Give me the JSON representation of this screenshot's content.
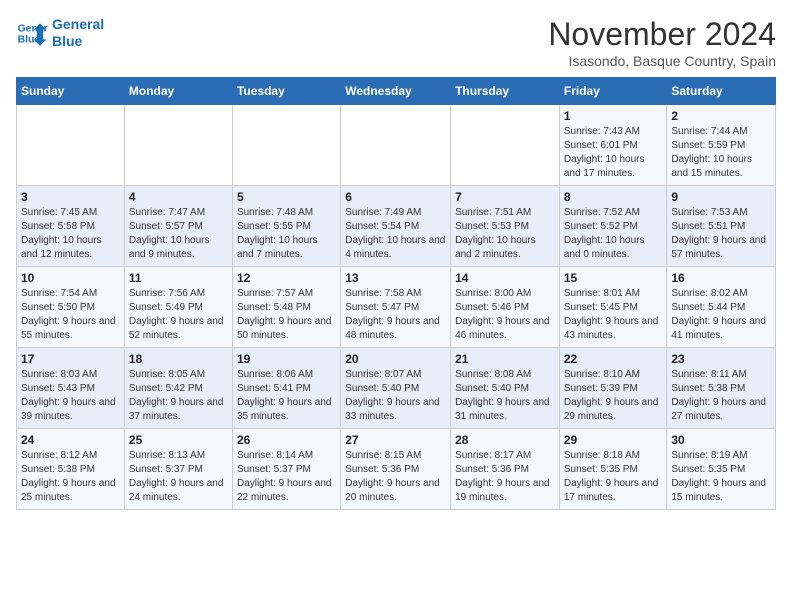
{
  "header": {
    "logo_line1": "General",
    "logo_line2": "Blue",
    "month": "November 2024",
    "location": "Isasondo, Basque Country, Spain"
  },
  "weekdays": [
    "Sunday",
    "Monday",
    "Tuesday",
    "Wednesday",
    "Thursday",
    "Friday",
    "Saturday"
  ],
  "weeks": [
    [
      {
        "day": "",
        "info": ""
      },
      {
        "day": "",
        "info": ""
      },
      {
        "day": "",
        "info": ""
      },
      {
        "day": "",
        "info": ""
      },
      {
        "day": "",
        "info": ""
      },
      {
        "day": "1",
        "info": "Sunrise: 7:43 AM\nSunset: 6:01 PM\nDaylight: 10 hours and 17 minutes."
      },
      {
        "day": "2",
        "info": "Sunrise: 7:44 AM\nSunset: 5:59 PM\nDaylight: 10 hours and 15 minutes."
      }
    ],
    [
      {
        "day": "3",
        "info": "Sunrise: 7:45 AM\nSunset: 5:58 PM\nDaylight: 10 hours and 12 minutes."
      },
      {
        "day": "4",
        "info": "Sunrise: 7:47 AM\nSunset: 5:57 PM\nDaylight: 10 hours and 9 minutes."
      },
      {
        "day": "5",
        "info": "Sunrise: 7:48 AM\nSunset: 5:55 PM\nDaylight: 10 hours and 7 minutes."
      },
      {
        "day": "6",
        "info": "Sunrise: 7:49 AM\nSunset: 5:54 PM\nDaylight: 10 hours and 4 minutes."
      },
      {
        "day": "7",
        "info": "Sunrise: 7:51 AM\nSunset: 5:53 PM\nDaylight: 10 hours and 2 minutes."
      },
      {
        "day": "8",
        "info": "Sunrise: 7:52 AM\nSunset: 5:52 PM\nDaylight: 10 hours and 0 minutes."
      },
      {
        "day": "9",
        "info": "Sunrise: 7:53 AM\nSunset: 5:51 PM\nDaylight: 9 hours and 57 minutes."
      }
    ],
    [
      {
        "day": "10",
        "info": "Sunrise: 7:54 AM\nSunset: 5:50 PM\nDaylight: 9 hours and 55 minutes."
      },
      {
        "day": "11",
        "info": "Sunrise: 7:56 AM\nSunset: 5:49 PM\nDaylight: 9 hours and 52 minutes."
      },
      {
        "day": "12",
        "info": "Sunrise: 7:57 AM\nSunset: 5:48 PM\nDaylight: 9 hours and 50 minutes."
      },
      {
        "day": "13",
        "info": "Sunrise: 7:58 AM\nSunset: 5:47 PM\nDaylight: 9 hours and 48 minutes."
      },
      {
        "day": "14",
        "info": "Sunrise: 8:00 AM\nSunset: 5:46 PM\nDaylight: 9 hours and 46 minutes."
      },
      {
        "day": "15",
        "info": "Sunrise: 8:01 AM\nSunset: 5:45 PM\nDaylight: 9 hours and 43 minutes."
      },
      {
        "day": "16",
        "info": "Sunrise: 8:02 AM\nSunset: 5:44 PM\nDaylight: 9 hours and 41 minutes."
      }
    ],
    [
      {
        "day": "17",
        "info": "Sunrise: 8:03 AM\nSunset: 5:43 PM\nDaylight: 9 hours and 39 minutes."
      },
      {
        "day": "18",
        "info": "Sunrise: 8:05 AM\nSunset: 5:42 PM\nDaylight: 9 hours and 37 minutes."
      },
      {
        "day": "19",
        "info": "Sunrise: 8:06 AM\nSunset: 5:41 PM\nDaylight: 9 hours and 35 minutes."
      },
      {
        "day": "20",
        "info": "Sunrise: 8:07 AM\nSunset: 5:40 PM\nDaylight: 9 hours and 33 minutes."
      },
      {
        "day": "21",
        "info": "Sunrise: 8:08 AM\nSunset: 5:40 PM\nDaylight: 9 hours and 31 minutes."
      },
      {
        "day": "22",
        "info": "Sunrise: 8:10 AM\nSunset: 5:39 PM\nDaylight: 9 hours and 29 minutes."
      },
      {
        "day": "23",
        "info": "Sunrise: 8:11 AM\nSunset: 5:38 PM\nDaylight: 9 hours and 27 minutes."
      }
    ],
    [
      {
        "day": "24",
        "info": "Sunrise: 8:12 AM\nSunset: 5:38 PM\nDaylight: 9 hours and 25 minutes."
      },
      {
        "day": "25",
        "info": "Sunrise: 8:13 AM\nSunset: 5:37 PM\nDaylight: 9 hours and 24 minutes."
      },
      {
        "day": "26",
        "info": "Sunrise: 8:14 AM\nSunset: 5:37 PM\nDaylight: 9 hours and 22 minutes."
      },
      {
        "day": "27",
        "info": "Sunrise: 8:15 AM\nSunset: 5:36 PM\nDaylight: 9 hours and 20 minutes."
      },
      {
        "day": "28",
        "info": "Sunrise: 8:17 AM\nSunset: 5:36 PM\nDaylight: 9 hours and 19 minutes."
      },
      {
        "day": "29",
        "info": "Sunrise: 8:18 AM\nSunset: 5:35 PM\nDaylight: 9 hours and 17 minutes."
      },
      {
        "day": "30",
        "info": "Sunrise: 8:19 AM\nSunset: 5:35 PM\nDaylight: 9 hours and 15 minutes."
      }
    ]
  ]
}
